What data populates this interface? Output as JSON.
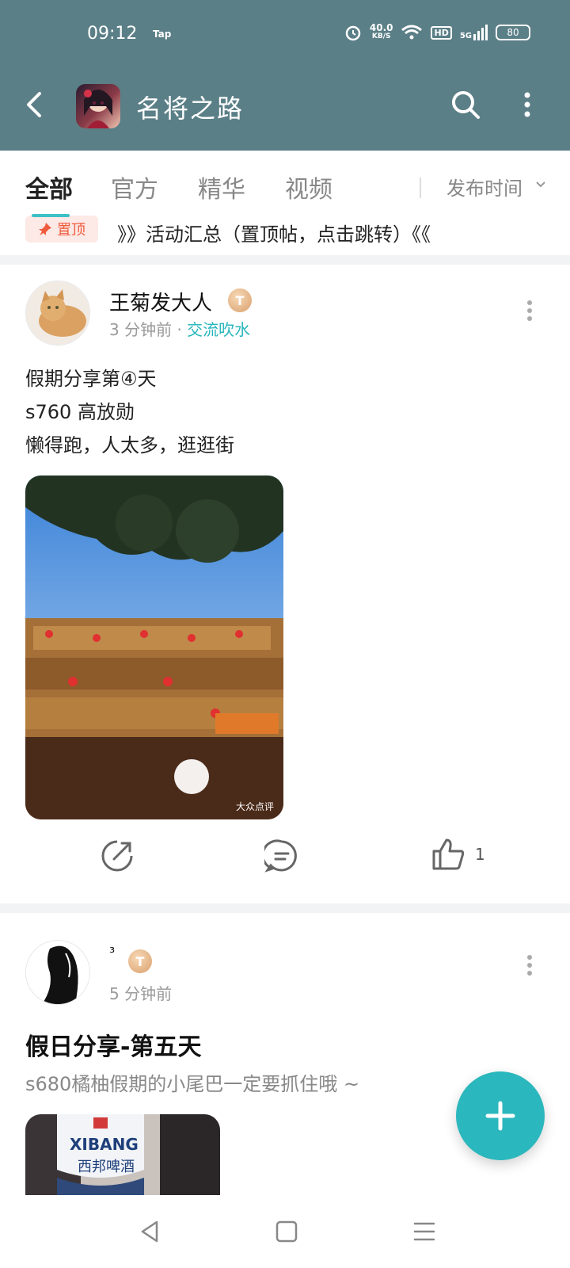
{
  "status": {
    "time": "09:12",
    "tap": "Tap",
    "speed_value": "40.0",
    "speed_unit": "KB/S",
    "hd": "HD",
    "signal": "5G",
    "battery": "80"
  },
  "header": {
    "title": "名将之路"
  },
  "tabs": [
    "全部",
    "官方",
    "精华",
    "视频"
  ],
  "sort": {
    "label": "发布时间"
  },
  "pinned": {
    "badge": "置顶",
    "text": "》》活动汇总（置顶帖，点击跳转）《《"
  },
  "posts": [
    {
      "author": "王菊发大人",
      "badge": "T",
      "time": "3 分钟前",
      "dot": "·",
      "topic": "交流吹水",
      "lines": [
        "假期分享第④天",
        "s760 高放勋",
        "懒得跑，人太多，逛逛街"
      ],
      "watermark": "大众点评",
      "likes": "1"
    },
    {
      "author": "³",
      "badge": "T",
      "time": "5 分钟前",
      "title": "假日分享-第五天",
      "summary": "s680橘柚假期的小尾巴一定要抓住哦 ~",
      "photo_text": "XIBANG",
      "photo_subtext": "西邦啤酒"
    }
  ],
  "colors": {
    "header_bg": "#5b7f87",
    "accent": "#2ab7bd",
    "pin_red": "#ef5a3c"
  }
}
